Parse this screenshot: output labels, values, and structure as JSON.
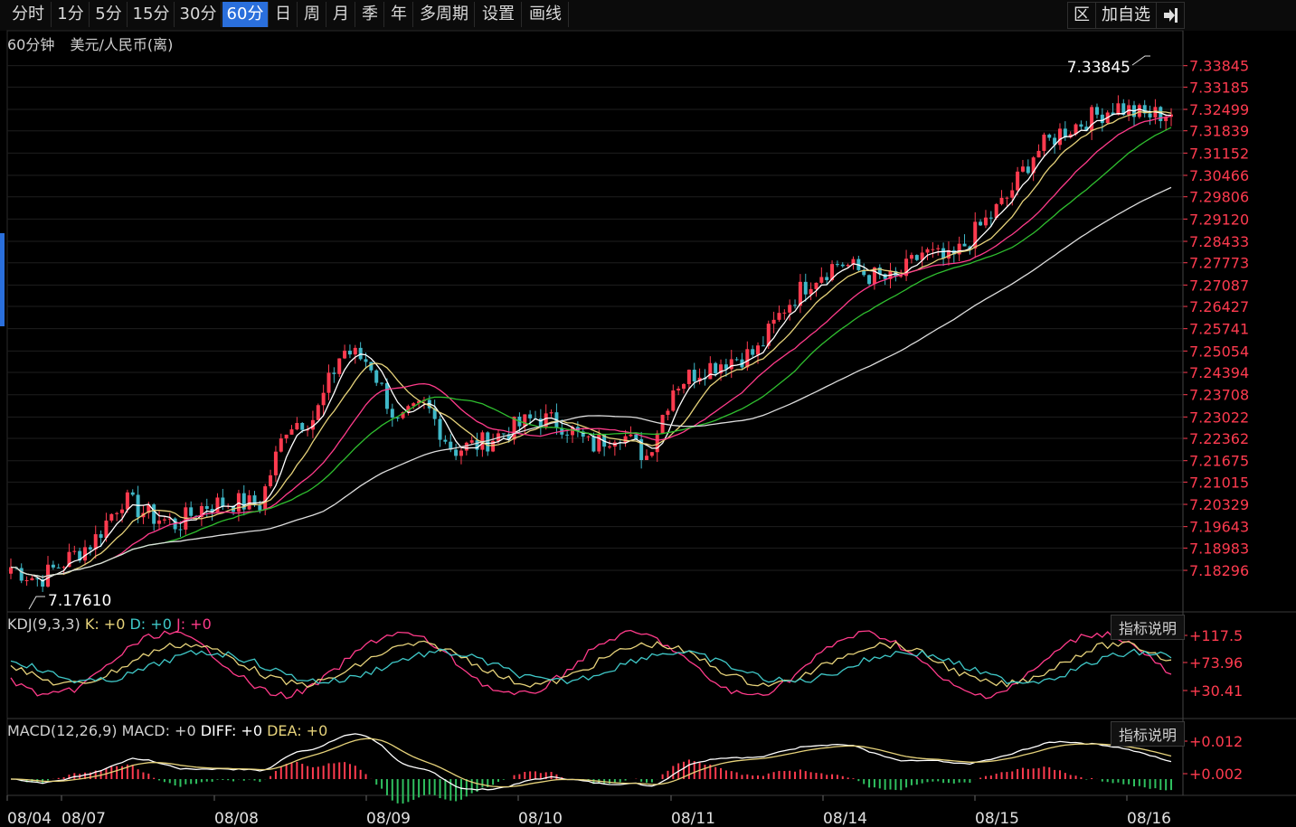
{
  "toolbar": {
    "tabs": [
      "分时",
      "1分",
      "5分",
      "15分",
      "30分",
      "60分",
      "日",
      "周",
      "月",
      "季",
      "年",
      "多周期",
      "设置",
      "画线"
    ],
    "active_tab": "60分",
    "right": {
      "zone": "区",
      "add_fav": "加自选",
      "exit_icon": "exit-icon"
    }
  },
  "header": {
    "period": "60分钟",
    "symbol": "美元/人民币(离)"
  },
  "colors": {
    "up": "#ff3b4f",
    "down": "#3fb8c8",
    "ma5": "#ffffff",
    "ma10": "#e6d27a",
    "ma20": "#ff3b8a",
    "ma30": "#2fbf2f",
    "ma60": "#dddddd",
    "accent": "#2a6fdc"
  },
  "chart_data": {
    "type": "candlestick",
    "price_axis": [
      "7.33845",
      "7.33185",
      "7.32499",
      "7.31839",
      "7.31152",
      "7.30466",
      "7.29806",
      "7.29120",
      "7.28433",
      "7.27773",
      "7.27087",
      "7.26427",
      "7.25741",
      "7.25054",
      "7.24394",
      "7.23708",
      "7.23022",
      "7.22362",
      "7.21675",
      "7.21015",
      "7.20329",
      "7.19643",
      "7.18983",
      "7.18296"
    ],
    "ylim": [
      7.1774,
      7.3417
    ],
    "x_dates": [
      "08/04",
      "08/07",
      "08/08",
      "08/09",
      "08/10",
      "08/11",
      "08/14",
      "08/15",
      "08/16"
    ],
    "max_label": "7.33845",
    "min_label": "7.17610",
    "close_anchors": [
      7.184,
      7.18,
      7.186,
      7.192,
      7.205,
      7.2,
      7.197,
      7.203,
      7.204,
      7.203,
      7.228,
      7.23,
      7.251,
      7.247,
      7.228,
      7.234,
      7.22,
      7.222,
      7.226,
      7.23,
      7.228,
      7.221,
      7.226,
      7.218,
      7.24,
      7.245,
      7.248,
      7.25,
      7.264,
      7.273,
      7.278,
      7.274,
      7.272,
      7.281,
      7.278,
      7.288,
      7.297,
      7.311,
      7.318,
      7.322,
      7.326,
      7.323,
      7.324
    ],
    "kdj": {
      "label": "KDJ(9,3,3)",
      "k_label": "K: +0",
      "d_label": "D: +0",
      "j_label": "J: +0",
      "axis": [
        "+117.5",
        "+73.96",
        "+30.41"
      ]
    },
    "macd": {
      "label": "MACD(12,26,9)",
      "macd_label": "MACD: +0",
      "diff_label": "DIFF: +0",
      "dea_label": "DEA: +0",
      "axis": [
        "+0.012",
        "+0.002"
      ]
    },
    "explain_label": "指标说明"
  }
}
